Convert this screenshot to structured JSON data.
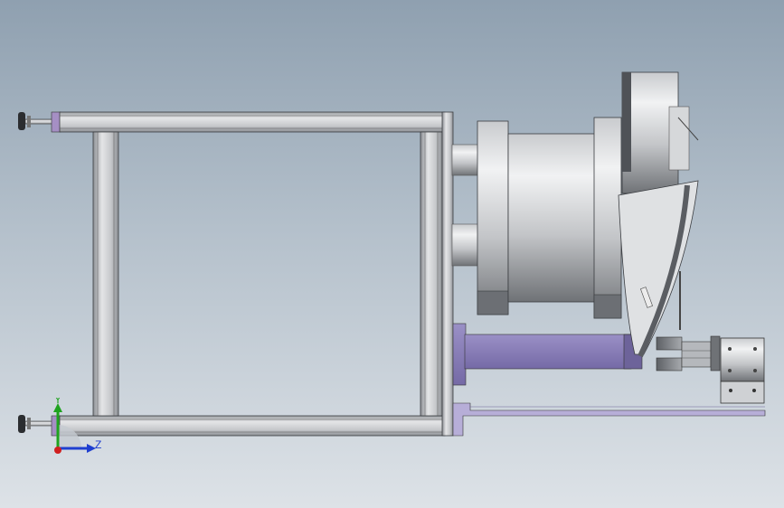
{
  "viewport": {
    "background_top": "#8fa0b0",
    "background_bottom": "#dde2e7"
  },
  "colors": {
    "frame_metal": "#b9bcc0",
    "frame_edge": "#3a3c40",
    "purple_part": "#8a7fb6",
    "purple_light": "#b7aed8",
    "drum_light": "#d7d8da",
    "drum_dark": "#7d8085"
  },
  "triad": {
    "y_label": "Y",
    "z_label": "Z",
    "y_color": "#1fa31f",
    "z_color": "#1f3fd0",
    "x_color": "#d01f1f"
  }
}
